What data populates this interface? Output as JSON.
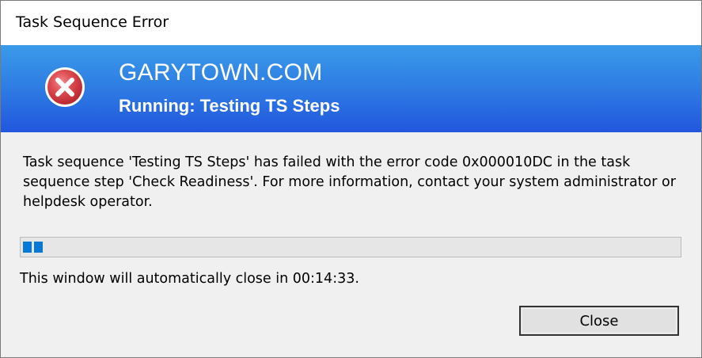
{
  "window": {
    "title": "Task Sequence Error"
  },
  "banner": {
    "brand": "GARYTOWN.COM",
    "running": "Running: Testing TS Steps",
    "icon": "error-x-circle-icon",
    "gradient_top": "#3a9be9",
    "gradient_bottom": "#2157de",
    "icon_color": "#d9373d"
  },
  "message": {
    "text": "Task sequence 'Testing TS Steps' has failed with the error code 0x000010DC in the task sequence step 'Check Readiness'. For more information, contact your system administrator or helpdesk operator."
  },
  "progress": {
    "percent": 4,
    "fill_color": "#0679d7"
  },
  "countdown": {
    "text": "This window will automatically close in 00:14:33."
  },
  "buttons": {
    "close_label": "Close"
  }
}
